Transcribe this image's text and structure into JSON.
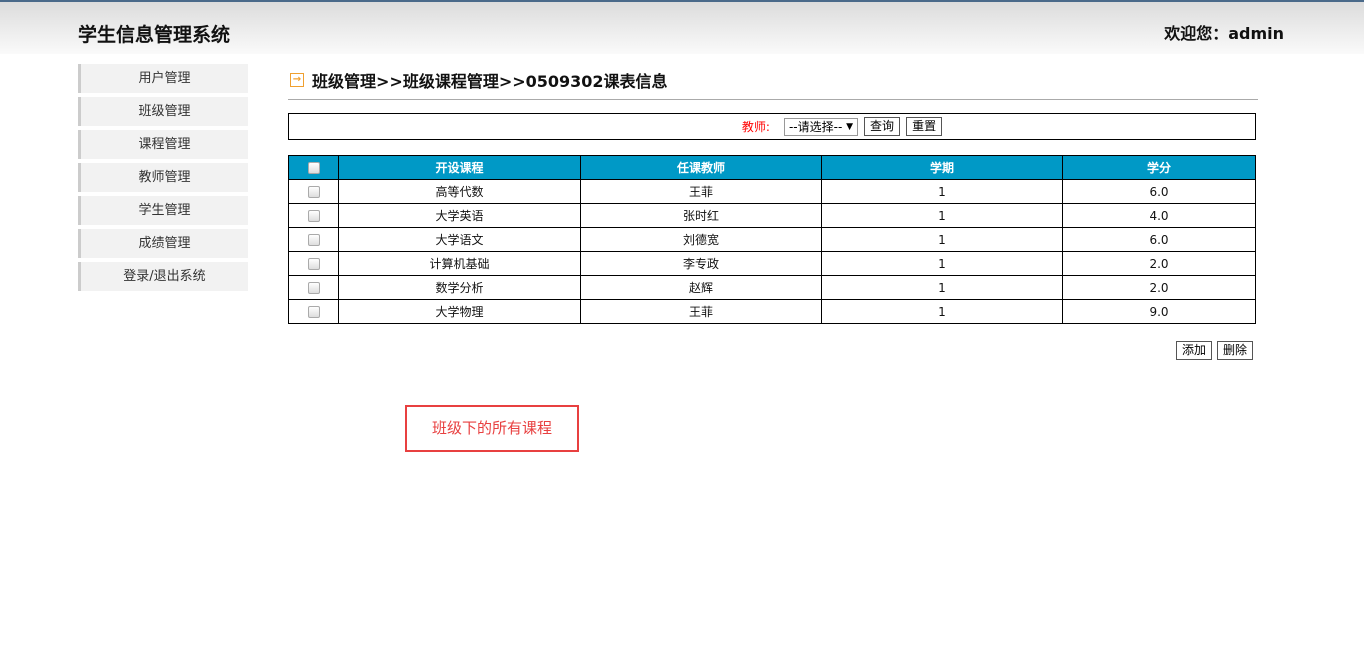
{
  "header": {
    "title": "学生信息管理系统",
    "welcome": "欢迎您：admin"
  },
  "sidebar": {
    "items": [
      "用户管理",
      "班级管理",
      "课程管理",
      "教师管理",
      "学生管理",
      "成绩管理",
      "登录/退出系统"
    ]
  },
  "breadcrumb": "班级管理>>班级课程管理>>0509302课表信息",
  "filter": {
    "label": "教师:",
    "select": "--请选择--",
    "query": "查询",
    "reset": "重置"
  },
  "table": {
    "headers": [
      "开设课程",
      "任课教师",
      "学期",
      "学分"
    ],
    "rows": [
      [
        "高等代数",
        "王菲",
        "1",
        "6.0"
      ],
      [
        "大学英语",
        "张时红",
        "1",
        "4.0"
      ],
      [
        "大学语文",
        "刘德宽",
        "1",
        "6.0"
      ],
      [
        "计算机基础",
        "李专政",
        "1",
        "2.0"
      ],
      [
        "数学分析",
        "赵辉",
        "1",
        "2.0"
      ],
      [
        "大学物理",
        "王菲",
        "1",
        "9.0"
      ]
    ]
  },
  "actions": {
    "add": "添加",
    "delete": "删除"
  },
  "annotation": "班级下的所有课程"
}
